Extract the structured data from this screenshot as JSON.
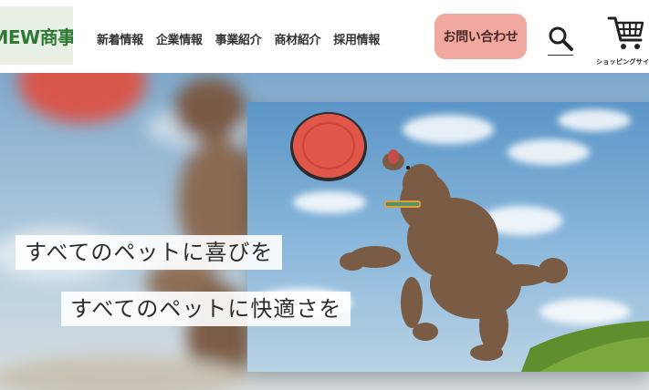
{
  "header": {
    "logo_text": "MEW商事",
    "nav": [
      {
        "label": "新着情報"
      },
      {
        "label": "企業情報"
      },
      {
        "label": "事業紹介"
      },
      {
        "label": "商材紹介"
      },
      {
        "label": "採用情報"
      }
    ],
    "contact_label": "お問い合わせ",
    "search_icon": "search-icon",
    "cart_icon": "shopping-cart-icon",
    "cart_label": "ショッピングサイ"
  },
  "hero": {
    "taglines": [
      "すべてのペットに喜びを",
      "すべてのペットに快適さを"
    ]
  },
  "colors": {
    "brand_green": "#2e7a32",
    "contact_pink": "#f0a8a0",
    "logo_bg": "#e9f1e7"
  }
}
